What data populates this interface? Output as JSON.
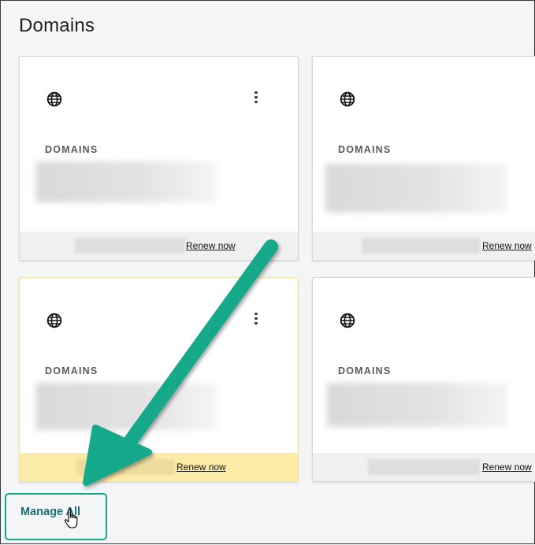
{
  "page": {
    "title": "Domains"
  },
  "cards": [
    {
      "label": "DOMAINS",
      "renew": "Renew now",
      "has_menu": true,
      "highlight": false
    },
    {
      "label": "DOMAINS",
      "renew": "Renew now",
      "has_menu": false,
      "highlight": false
    },
    {
      "label": "DOMAINS",
      "renew": "Renew now",
      "has_menu": true,
      "highlight": true
    },
    {
      "label": "DOMAINS",
      "renew": "Renew now",
      "has_menu": false,
      "highlight": false
    }
  ],
  "footer": {
    "manage_all": "Manage All"
  },
  "icons": {
    "card": "globe-icon",
    "menu": "more-vertical-icon",
    "pointer": "hand-cursor-icon",
    "annotation": "arrow-annotation"
  },
  "colors": {
    "highlight_footer": "#fdeca8",
    "annotation": "#14a88a",
    "link": "#1a6e78"
  }
}
